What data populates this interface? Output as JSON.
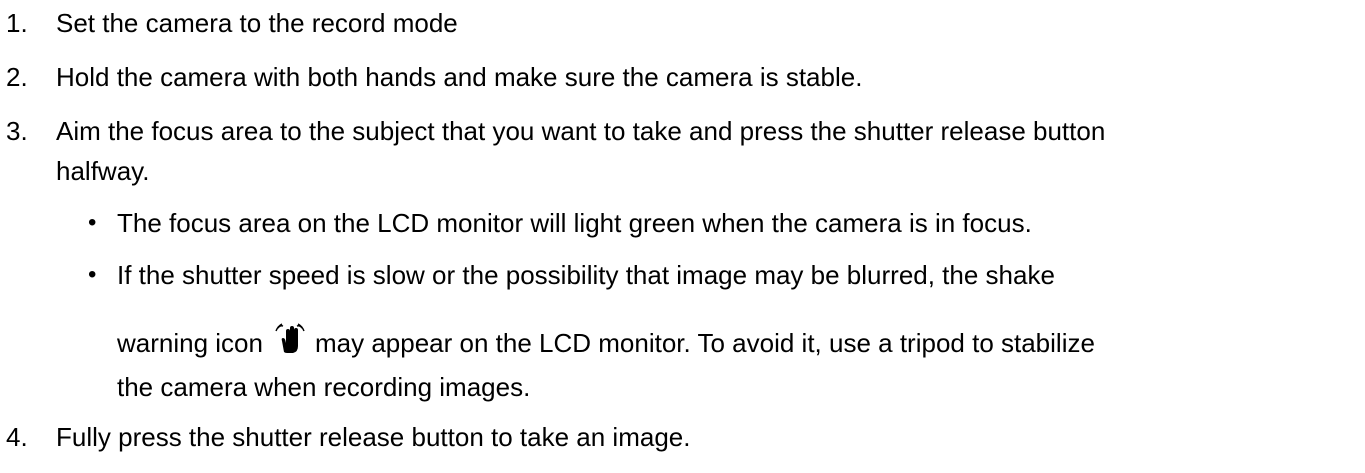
{
  "steps": [
    {
      "num": "1.",
      "text": "Set the camera to the record mode"
    },
    {
      "num": "2.",
      "text": "Hold the camera with both hands and make sure the camera is stable."
    },
    {
      "num": "3.",
      "text": "Aim the focus area to the subject that you want to take and press the shutter release button",
      "text_cont": "halfway."
    },
    {
      "num": "4.",
      "text": "Fully press the shutter release button to take an image."
    }
  ],
  "bullets": [
    {
      "symbol": "•",
      "text": "The focus area on the LCD monitor will light green when the camera is in focus."
    },
    {
      "symbol": "•",
      "text": "If the shutter speed is slow or the possibility that image may be blurred, the shake",
      "text_before_icon": "warning icon",
      "icon": "shake-warning-icon",
      "text_after_icon": "may appear on the LCD monitor. To avoid it, use a tripod to stabilize",
      "text_last": "the camera when recording images."
    }
  ]
}
